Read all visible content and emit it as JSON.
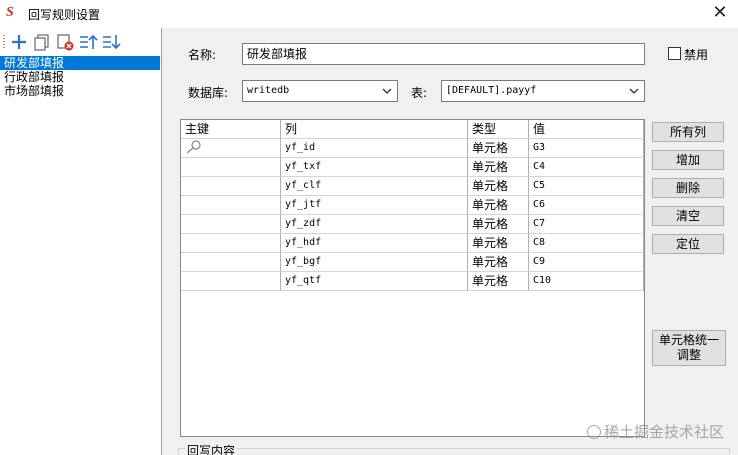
{
  "window": {
    "title": "回写规则设置",
    "close_glyph": "✕",
    "app_icon_glyph": "S"
  },
  "toolbar": {
    "buttons": [
      {
        "name": "add-icon",
        "color": "#2e6fd8"
      },
      {
        "name": "copy-icon",
        "color": "#555555"
      },
      {
        "name": "delete-icon",
        "color": "#d9301e"
      },
      {
        "name": "move-up-icon",
        "color": "#2e6fd8"
      },
      {
        "name": "move-down-icon",
        "color": "#2e6fd8"
      }
    ]
  },
  "rules": [
    {
      "label": "研发部填报",
      "selected": true
    },
    {
      "label": "行政部填报",
      "selected": false
    },
    {
      "label": "市场部填报",
      "selected": false
    }
  ],
  "form": {
    "name_label": "名称:",
    "name_value": "研发部填报",
    "disabled_label": "禁用",
    "disabled_checked": false,
    "database_label": "数据库:",
    "database_value": "writedb",
    "table_label": "表:",
    "table_value": "[DEFAULT].payyf"
  },
  "grid": {
    "columns": [
      "主键",
      "列",
      "类型",
      "值"
    ],
    "rows": [
      {
        "key": true,
        "column": "yf_id",
        "type": "单元格",
        "value": "G3"
      },
      {
        "key": false,
        "column": "yf_txf",
        "type": "单元格",
        "value": "C4"
      },
      {
        "key": false,
        "column": "yf_clf",
        "type": "单元格",
        "value": "C5"
      },
      {
        "key": false,
        "column": "yf_jtf",
        "type": "单元格",
        "value": "C6"
      },
      {
        "key": false,
        "column": "yf_zdf",
        "type": "单元格",
        "value": "C7"
      },
      {
        "key": false,
        "column": "yf_hdf",
        "type": "单元格",
        "value": "C8"
      },
      {
        "key": false,
        "column": "yf_bgf",
        "type": "单元格",
        "value": "C9"
      },
      {
        "key": false,
        "column": "yf_qtf",
        "type": "单元格",
        "value": "C10"
      }
    ]
  },
  "actions": {
    "all_columns": "所有列",
    "add": "增加",
    "delete": "删除",
    "clear": "清空",
    "locate": "定位",
    "unify_line1": "单元格统一",
    "unify_line2": "调整"
  },
  "writeback": {
    "group_label": "回写内容"
  },
  "watermark": {
    "text": "稀土掘金技术社区"
  }
}
